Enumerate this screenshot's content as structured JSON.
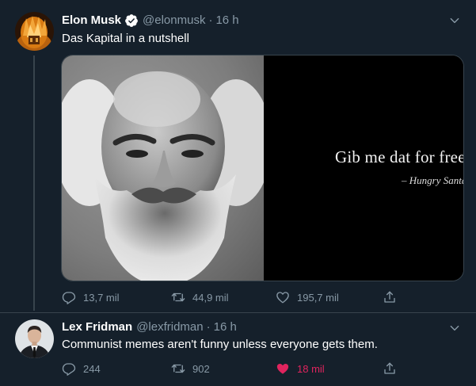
{
  "tweets": [
    {
      "display_name": "Elon Musk",
      "verified": true,
      "handle": "@elonmusk",
      "separator": "·",
      "time": "16 h",
      "text": "Das Kapital in a nutshell",
      "media": {
        "caption": "Gib me dat for free",
        "attribution": "– Hungry Santa"
      },
      "reply_count": "13,7 mil",
      "retweet_count": "44,9 mil",
      "like_count": "195,7 mil",
      "liked": false
    },
    {
      "display_name": "Lex Fridman",
      "verified": false,
      "handle": "@lexfridman",
      "separator": "·",
      "time": "16 h",
      "text": "Communist memes aren't funny unless everyone gets them.",
      "reply_count": "244",
      "retweet_count": "902",
      "like_count": "18 mil",
      "liked": true
    }
  ],
  "colors": {
    "background": "#15202b",
    "secondary_text": "#8899a6",
    "like_active": "#e0245e",
    "verified_badge": "#ffffff"
  },
  "icons": {
    "reply": "reply-icon",
    "retweet": "retweet-icon",
    "like": "heart-icon",
    "share": "share-icon",
    "more": "chevron-down-icon",
    "verified": "verified-badge-icon"
  }
}
